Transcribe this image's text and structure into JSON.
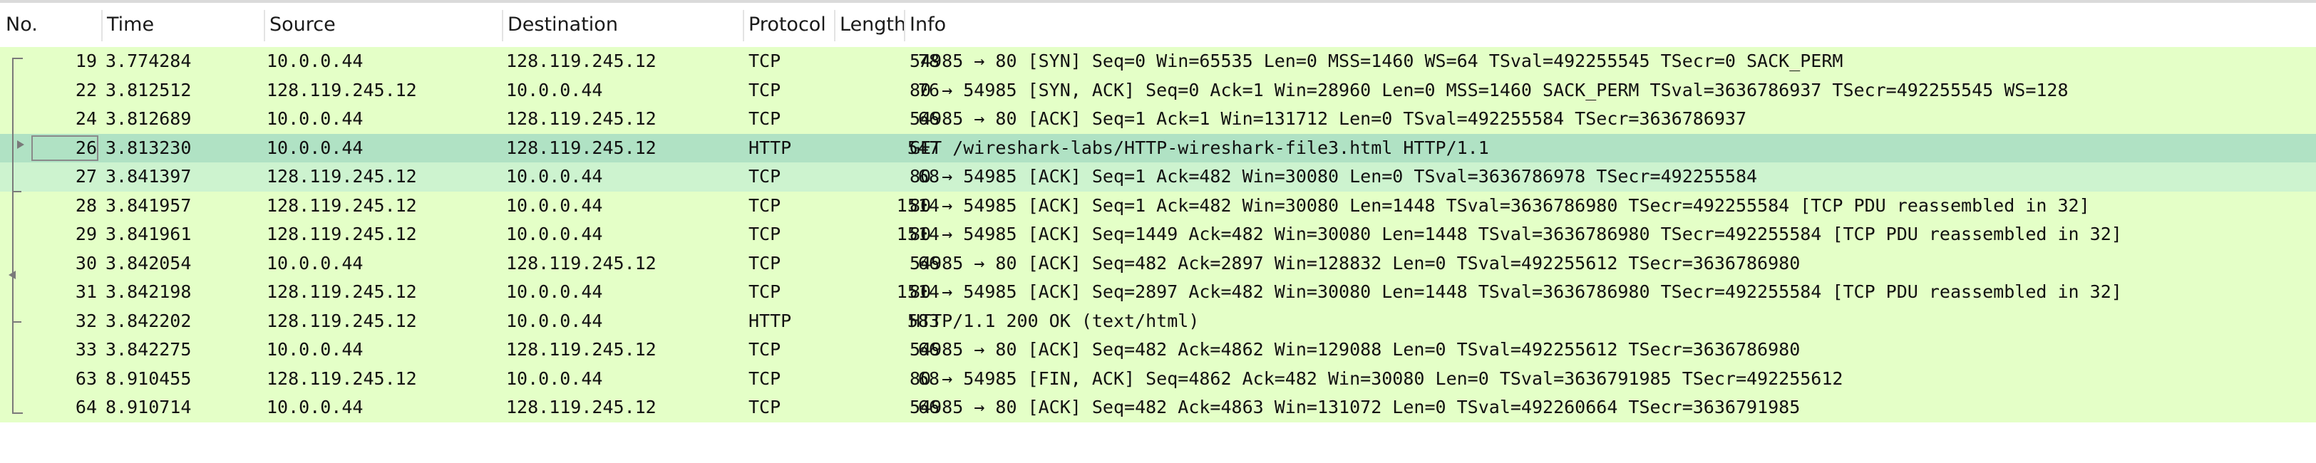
{
  "columns": {
    "no": "No.",
    "time": "Time",
    "source": "Source",
    "destination": "Destination",
    "protocol": "Protocol",
    "length": "Length",
    "info": "Info"
  },
  "packets": [
    {
      "no": "19",
      "time": "3.774284",
      "source": "10.0.0.44",
      "destination": "128.119.245.12",
      "protocol": "TCP",
      "length": "78",
      "info": "54985 → 80 [SYN] Seq=0 Win=65535 Len=0 MSS=1460 WS=64 TSval=492255545 TSecr=0 SACK_PERM"
    },
    {
      "no": "22",
      "time": "3.812512",
      "source": "128.119.245.12",
      "destination": "10.0.0.44",
      "protocol": "TCP",
      "length": "76",
      "info": "80 → 54985 [SYN, ACK] Seq=0 Ack=1 Win=28960 Len=0 MSS=1460 SACK_PERM TSval=3636786937 TSecr=492255545 WS=128"
    },
    {
      "no": "24",
      "time": "3.812689",
      "source": "10.0.0.44",
      "destination": "128.119.245.12",
      "protocol": "TCP",
      "length": "66",
      "info": "54985 → 80 [ACK] Seq=1 Ack=1 Win=131712 Len=0 TSval=492255584 TSecr=3636786937"
    },
    {
      "no": "26",
      "time": "3.813230",
      "source": "10.0.0.44",
      "destination": "128.119.245.12",
      "protocol": "HTTP",
      "length": "547",
      "info": "GET /wireshark-labs/HTTP-wireshark-file3.html HTTP/1.1"
    },
    {
      "no": "27",
      "time": "3.841397",
      "source": "128.119.245.12",
      "destination": "10.0.0.44",
      "protocol": "TCP",
      "length": "68",
      "info": "80 → 54985 [ACK] Seq=1 Ack=482 Win=30080 Len=0 TSval=3636786978 TSecr=492255584"
    },
    {
      "no": "28",
      "time": "3.841957",
      "source": "128.119.245.12",
      "destination": "10.0.0.44",
      "protocol": "TCP",
      "length": "1514",
      "info": "80 → 54985 [ACK] Seq=1 Ack=482 Win=30080 Len=1448 TSval=3636786980 TSecr=492255584 [TCP PDU reassembled in 32]"
    },
    {
      "no": "29",
      "time": "3.841961",
      "source": "128.119.245.12",
      "destination": "10.0.0.44",
      "protocol": "TCP",
      "length": "1514",
      "info": "80 → 54985 [ACK] Seq=1449 Ack=482 Win=30080 Len=1448 TSval=3636786980 TSecr=492255584 [TCP PDU reassembled in 32]"
    },
    {
      "no": "30",
      "time": "3.842054",
      "source": "10.0.0.44",
      "destination": "128.119.245.12",
      "protocol": "TCP",
      "length": "66",
      "info": "54985 → 80 [ACK] Seq=482 Ack=2897 Win=128832 Len=0 TSval=492255612 TSecr=3636786980"
    },
    {
      "no": "31",
      "time": "3.842198",
      "source": "128.119.245.12",
      "destination": "10.0.0.44",
      "protocol": "TCP",
      "length": "1514",
      "info": "80 → 54985 [ACK] Seq=2897 Ack=482 Win=30080 Len=1448 TSval=3636786980 TSecr=492255584 [TCP PDU reassembled in 32]"
    },
    {
      "no": "32",
      "time": "3.842202",
      "source": "128.119.245.12",
      "destination": "10.0.0.44",
      "protocol": "HTTP",
      "length": "583",
      "info": "HTTP/1.1 200 OK  (text/html)"
    },
    {
      "no": "33",
      "time": "3.842275",
      "source": "10.0.0.44",
      "destination": "128.119.245.12",
      "protocol": "TCP",
      "length": "66",
      "info": "54985 → 80 [ACK] Seq=482 Ack=4862 Win=129088 Len=0 TSval=492255612 TSecr=3636786980"
    },
    {
      "no": "63",
      "time": "8.910455",
      "source": "128.119.245.12",
      "destination": "10.0.0.44",
      "protocol": "TCP",
      "length": "68",
      "info": "80 → 54985 [FIN, ACK] Seq=4862 Ack=482 Win=30080 Len=0 TSval=3636791985 TSecr=492255612"
    },
    {
      "no": "64",
      "time": "8.910714",
      "source": "10.0.0.44",
      "destination": "128.119.245.12",
      "protocol": "TCP",
      "length": "66",
      "info": "54985 → 80 [ACK] Seq=482 Ack=4863 Win=131072 Len=0 TSval=492260664 TSecr=3636791985"
    }
  ],
  "colors": {
    "tcp_row": "#e4ffc7",
    "selected_row": "#b0e2c4",
    "related_row": "#cdf3cf"
  },
  "selected_packet": "26",
  "related_packet": "27"
}
